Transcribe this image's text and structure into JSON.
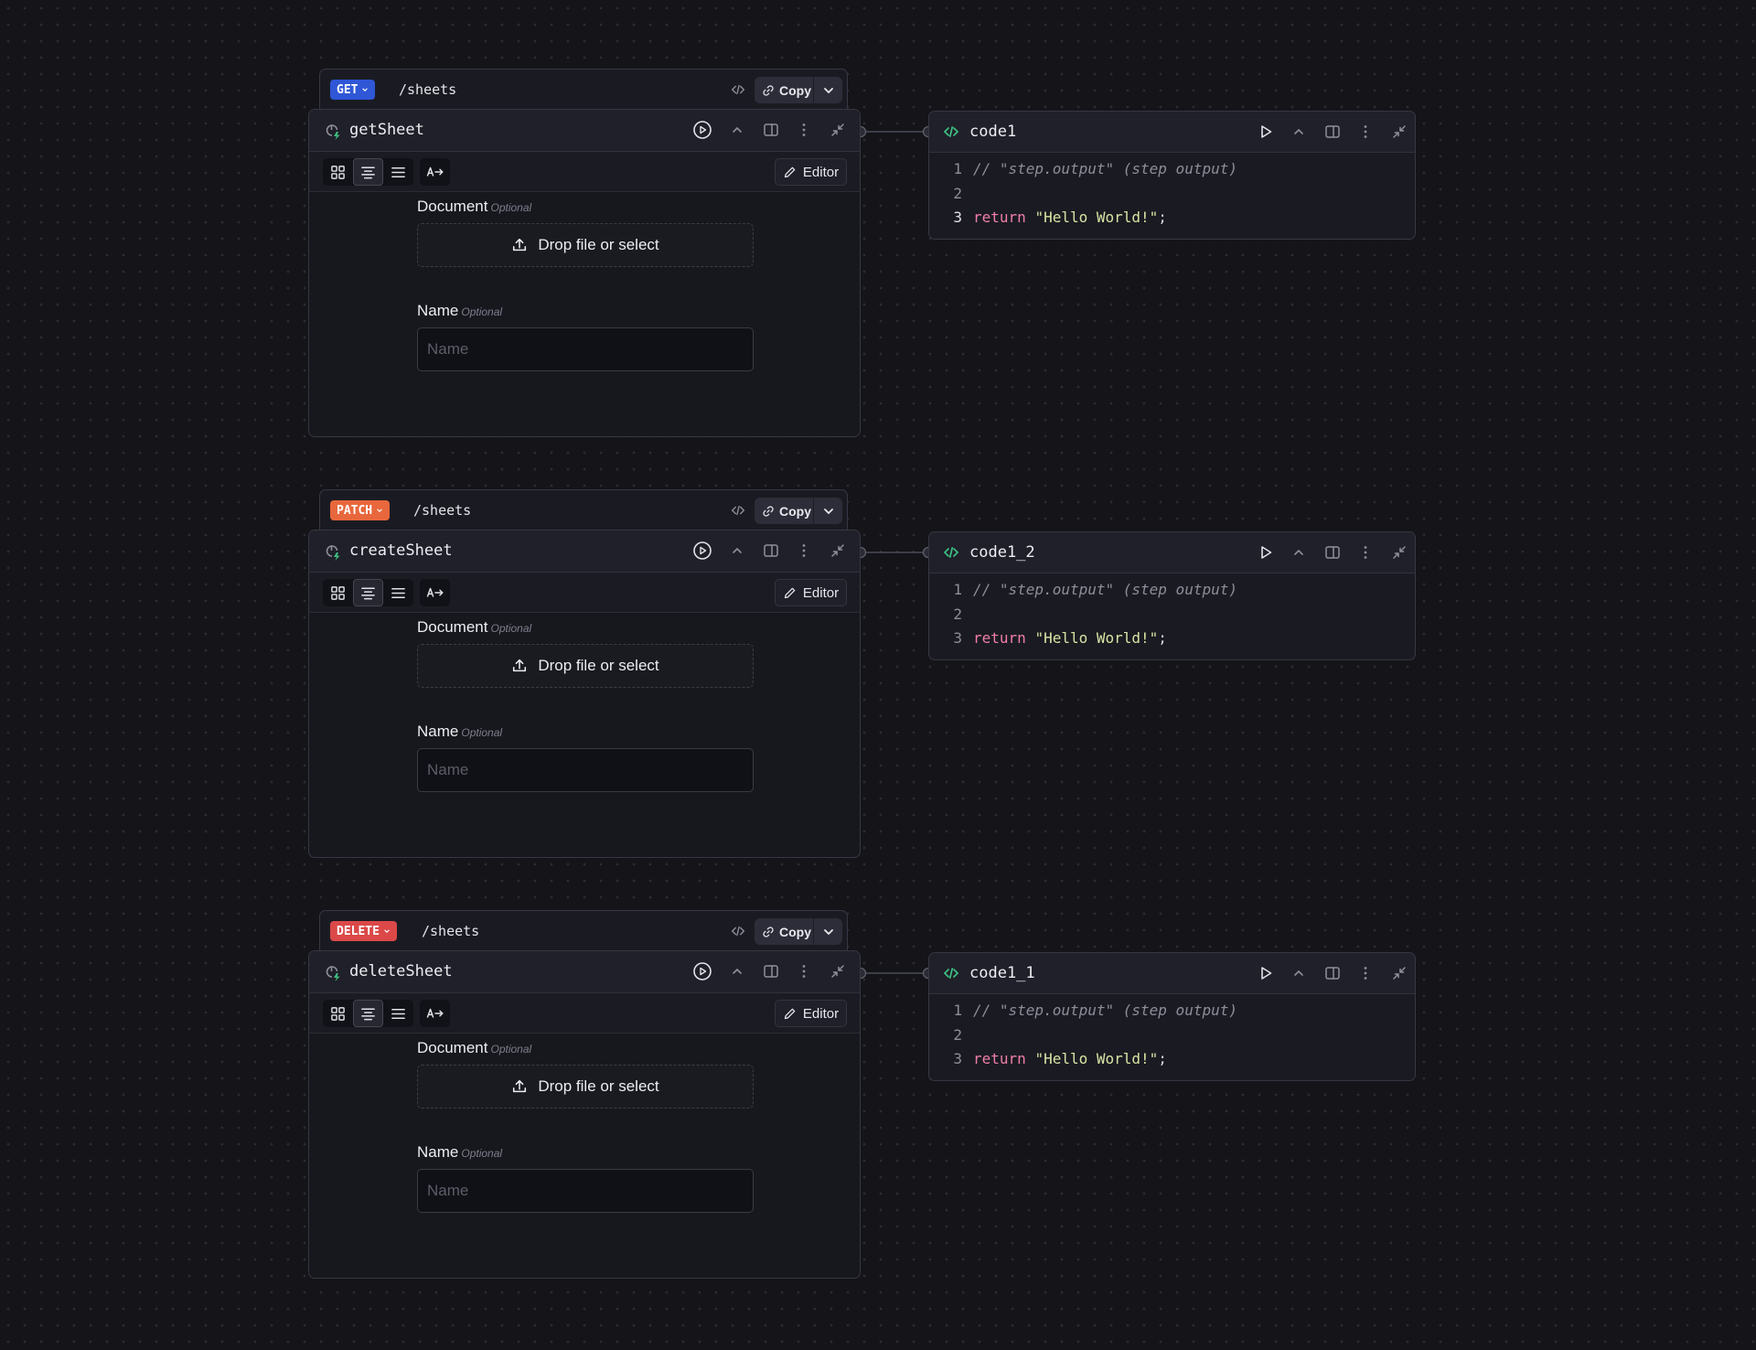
{
  "endpoints": [
    {
      "method": "GET",
      "method_color": "#2f57d6",
      "path": "/sheets",
      "copy_label": "Copy",
      "step_name": "getSheet",
      "editor_label": "Editor",
      "document_label": "Document",
      "document_optional": "Optional",
      "drop_label": "Drop file or select",
      "name_label": "Name",
      "name_optional": "Optional",
      "name_placeholder": "Name"
    },
    {
      "method": "PATCH",
      "method_color": "#e8673c",
      "path": "/sheets",
      "copy_label": "Copy",
      "step_name": "createSheet",
      "editor_label": "Editor",
      "document_label": "Document",
      "document_optional": "Optional",
      "drop_label": "Drop file or select",
      "name_label": "Name",
      "name_optional": "Optional",
      "name_placeholder": "Name"
    },
    {
      "method": "DELETE",
      "method_color": "#db4848",
      "path": "/sheets",
      "copy_label": "Copy",
      "step_name": "deleteSheet",
      "editor_label": "Editor",
      "document_label": "Document",
      "document_optional": "Optional",
      "drop_label": "Drop file or select",
      "name_label": "Name",
      "name_optional": "Optional",
      "name_placeholder": "Name"
    }
  ],
  "code_nodes": [
    {
      "title": "code1",
      "lines": [
        {
          "num": "1",
          "comment": "// \"step.output\" (step output)"
        },
        {
          "num": "2"
        },
        {
          "num": "3",
          "keyword": "return",
          "string": "\"Hello World!\"",
          "punct": ";"
        }
      ]
    },
    {
      "title": "code1_2",
      "lines": [
        {
          "num": "1",
          "comment": "// \"step.output\" (step output)"
        },
        {
          "num": "2"
        },
        {
          "num": "3",
          "keyword": "return",
          "string": "\"Hello World!\"",
          "punct": ";"
        }
      ]
    },
    {
      "title": "code1_1",
      "lines": [
        {
          "num": "1",
          "comment": "// \"step.output\" (step output)"
        },
        {
          "num": "2"
        },
        {
          "num": "3",
          "keyword": "return",
          "string": "\"Hello World!\"",
          "punct": ";"
        }
      ]
    }
  ],
  "icons": {
    "code": "code-icon",
    "link": "link-icon",
    "chevron": "chevron-down-icon",
    "play_circle": "play-circle-icon",
    "play": "play-icon",
    "collapse": "chevron-up-icon",
    "panel": "panel-icon",
    "more": "more-vertical-icon",
    "minimize": "minimize-icon",
    "upload": "upload-icon",
    "pencil": "pencil-icon"
  },
  "colors": {
    "accent_green": "#3fbf84",
    "background": "#141419"
  }
}
